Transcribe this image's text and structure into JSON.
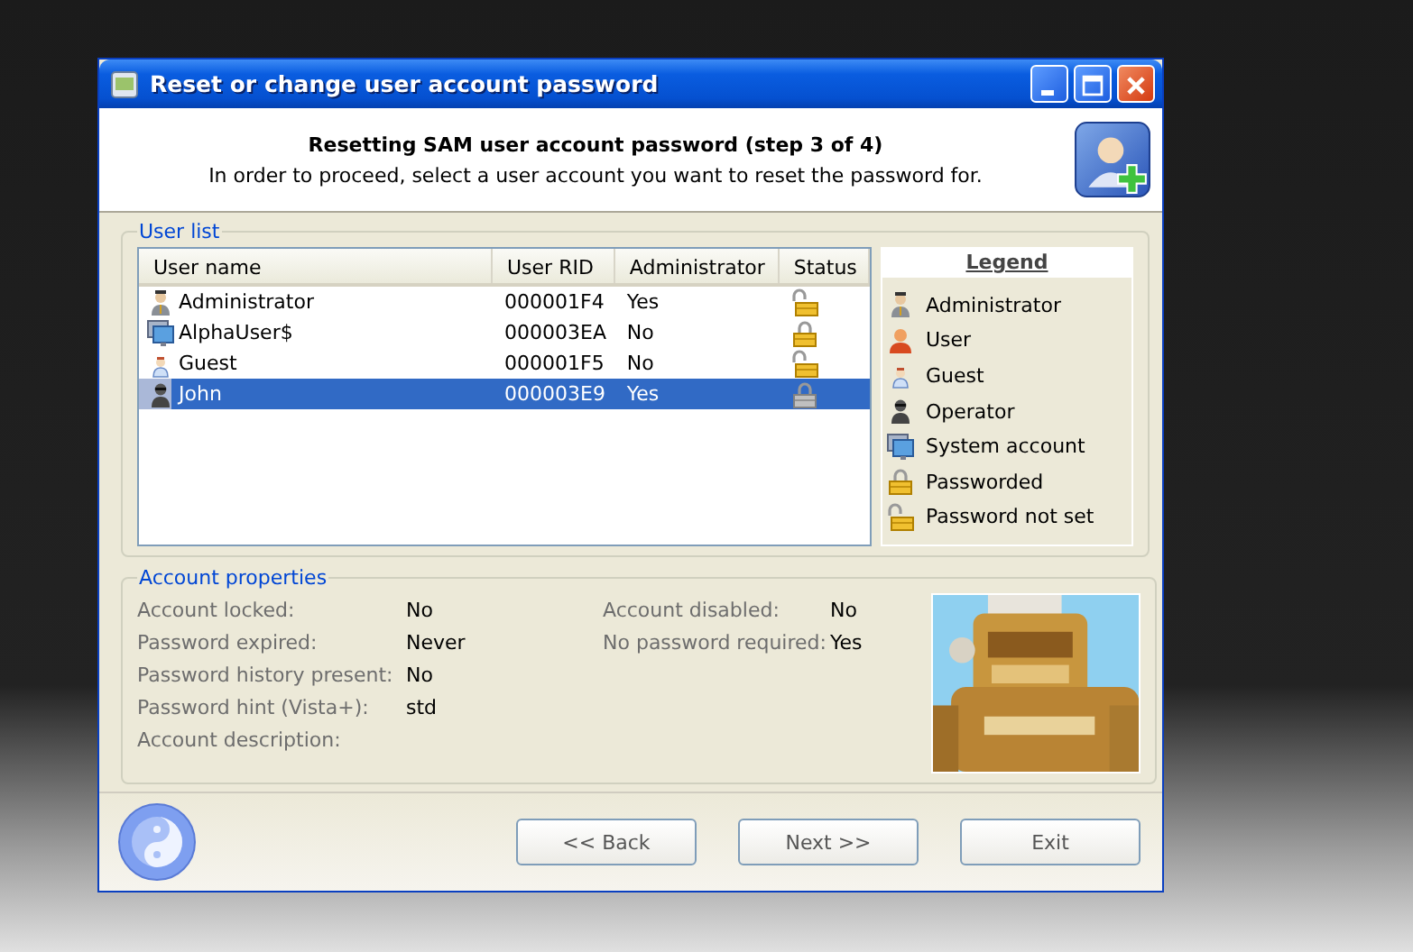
{
  "window": {
    "title": "Reset or change user account password"
  },
  "header": {
    "title": "Resetting SAM user account password (step 3 of 4)",
    "subtitle": "In order to proceed, select a user account you want to reset the password for."
  },
  "user_list": {
    "label": "User list",
    "columns": [
      "User name",
      "User RID",
      "Administrator",
      "Status"
    ],
    "rows": [
      {
        "kind": "administrator",
        "name": "Administrator",
        "rid": "000001F4",
        "admin": "Yes",
        "password_set": false,
        "selected": false
      },
      {
        "kind": "system",
        "name": "AlphaUser$",
        "rid": "000003EA",
        "admin": "No",
        "password_set": true,
        "selected": false
      },
      {
        "kind": "guest",
        "name": "Guest",
        "rid": "000001F5",
        "admin": "No",
        "password_set": false,
        "selected": false
      },
      {
        "kind": "operator",
        "name": "John",
        "rid": "000003E9",
        "admin": "Yes",
        "password_set": true,
        "selected": true
      }
    ]
  },
  "legend": {
    "title": "Legend",
    "items": [
      {
        "kind": "administrator",
        "label": "Administrator"
      },
      {
        "kind": "user",
        "label": "User"
      },
      {
        "kind": "guest",
        "label": "Guest"
      },
      {
        "kind": "operator",
        "label": "Operator"
      },
      {
        "kind": "system",
        "label": "System account"
      },
      {
        "kind": "passworded",
        "label": "Passworded"
      },
      {
        "kind": "not_set",
        "label": "Password not set"
      }
    ]
  },
  "account_properties": {
    "label": "Account properties",
    "left": [
      {
        "label": "Account locked:",
        "value": "No"
      },
      {
        "label": "Password expired:",
        "value": "Never"
      },
      {
        "label": "Password history present:",
        "value": "No"
      },
      {
        "label": "Password hint (Vista+):",
        "value": "std"
      },
      {
        "label": "Account description:"
      }
    ],
    "right": [
      {
        "label": "Account disabled:",
        "value": "No"
      },
      {
        "label": "No password required:",
        "value": "Yes"
      }
    ]
  },
  "buttons": [
    "<< Back",
    "Next >>",
    "Exit"
  ]
}
